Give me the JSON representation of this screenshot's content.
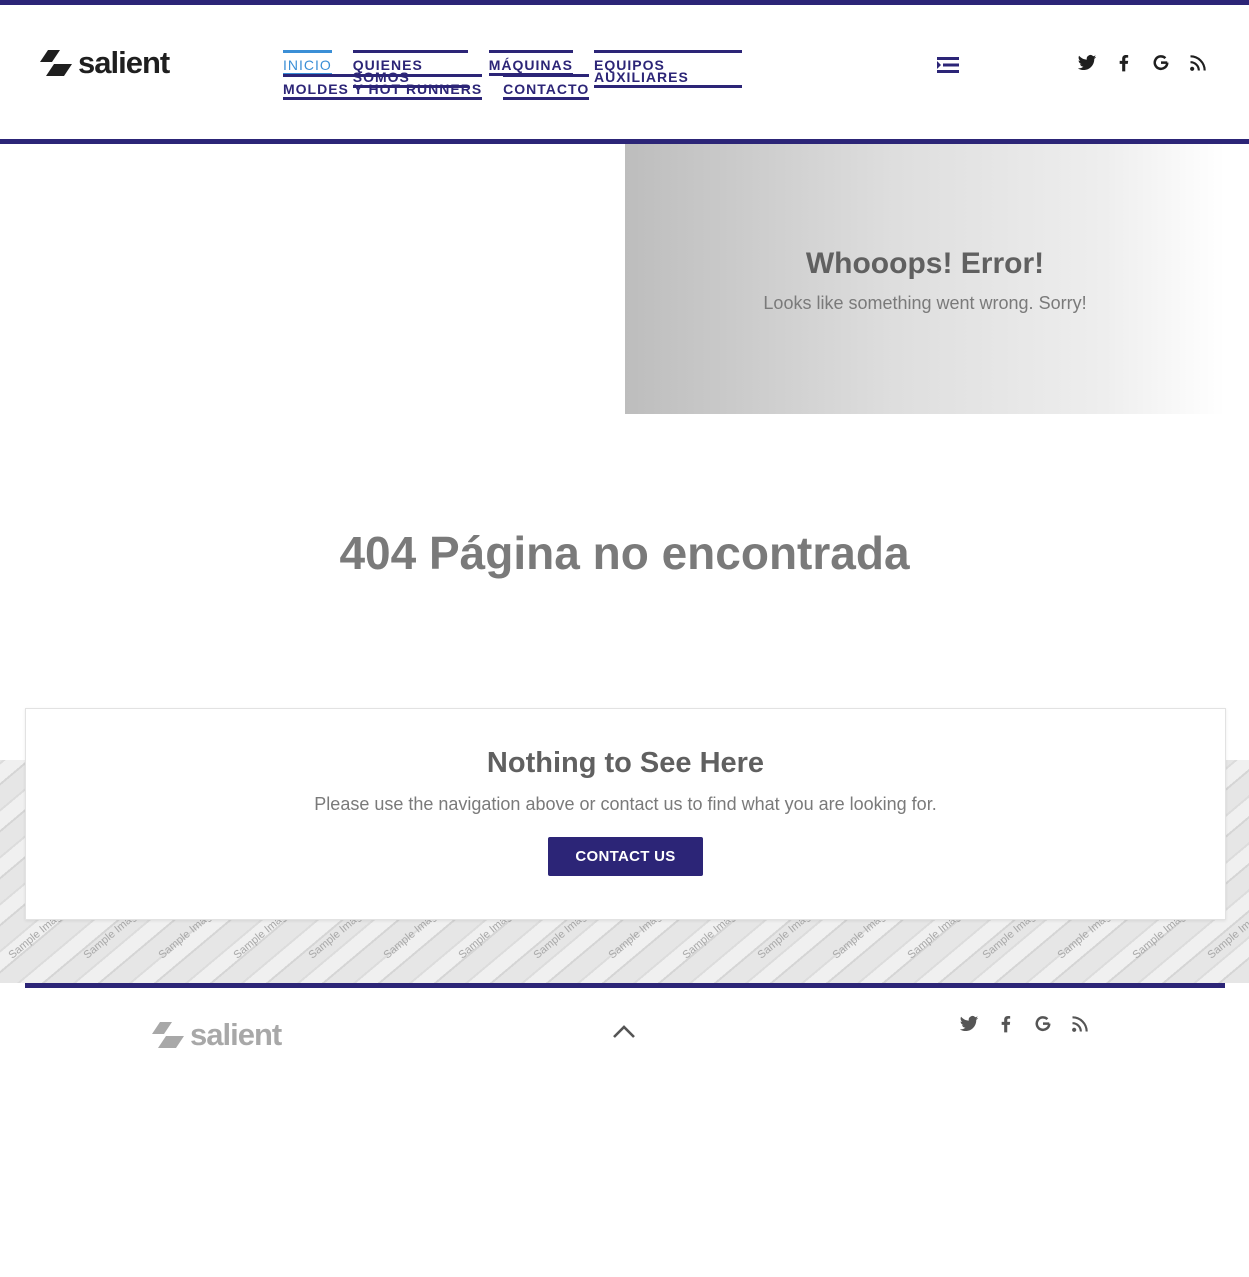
{
  "brand": {
    "name": "salient",
    "accent": "#2c2577",
    "active_nav_color": "#3b8fd6"
  },
  "nav": {
    "items": [
      {
        "label": "INICIO",
        "active": true
      },
      {
        "label": "QUIENES SOMOS"
      },
      {
        "label": "MÁQUINAS"
      },
      {
        "label": "EQUIPOS AUXILIARES"
      },
      {
        "label": "MOLDES Y HOT RUNNERS"
      },
      {
        "label": "CONTACTO"
      }
    ],
    "menu_toggle_icon": "menu-icon"
  },
  "social": [
    "twitter-icon",
    "facebook-icon",
    "google-icon",
    "rss-icon"
  ],
  "hero": {
    "title": "Whooops! Error!",
    "subtitle": "Looks like something went wrong. Sorry!"
  },
  "page": {
    "heading": "404 Página no encontrada"
  },
  "card": {
    "title": "Nothing to See Here",
    "text": "Please use the navigation above or contact us to find what you are looking for.",
    "button_label": "CONTACT US"
  },
  "background_pattern": {
    "label": "Sample Image"
  },
  "footer": {
    "logo": "salient",
    "back_to_top_icon": "chevron-up-icon"
  }
}
